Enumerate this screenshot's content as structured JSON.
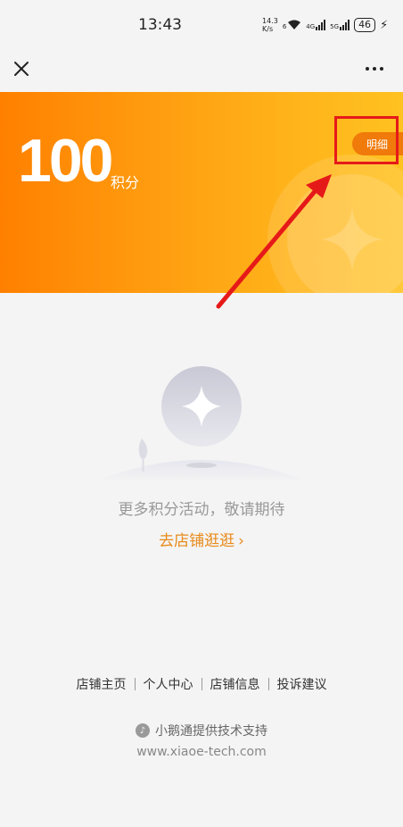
{
  "status_bar": {
    "time": "13:43",
    "net_speed_value": "14.3",
    "net_speed_unit": "K/s",
    "wifi_label": "6",
    "signal1_label": "4G",
    "signal2_label": "5G",
    "battery": "46"
  },
  "nav": {
    "close_icon": "close-icon",
    "more_icon": "more-icon"
  },
  "points": {
    "value": "100",
    "unit": "积分",
    "detail_label": "明细"
  },
  "empty_state": {
    "message": "更多积分活动，敬请期待",
    "shop_link": "去店铺逛逛",
    "chevron": "›"
  },
  "footer": {
    "links": [
      "店铺主页",
      "个人中心",
      "店铺信息",
      "投诉建议"
    ],
    "tech_support": "小鹅通提供技术支持",
    "url": "www.xiaoe-tech.com"
  },
  "colors": {
    "accent": "#ff9a0e",
    "link": "#e88a1a",
    "annotation": "#e61919"
  }
}
